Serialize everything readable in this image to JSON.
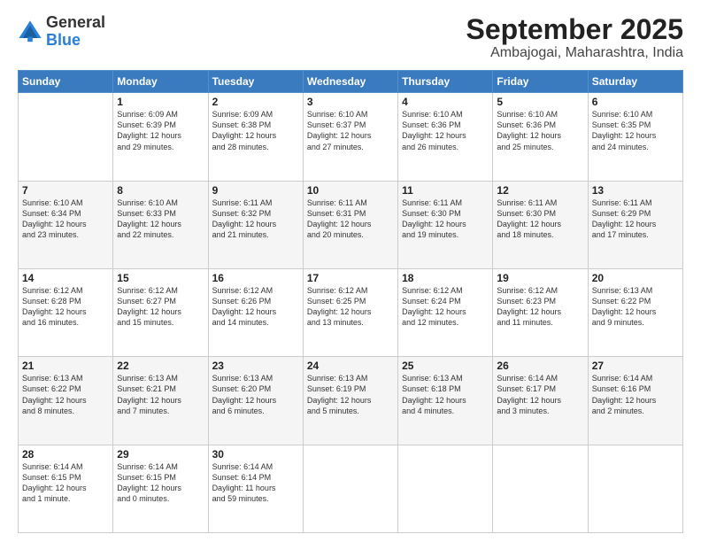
{
  "logo": {
    "general": "General",
    "blue": "Blue"
  },
  "header": {
    "month": "September 2025",
    "location": "Ambajogai, Maharashtra, India"
  },
  "weekdays": [
    "Sunday",
    "Monday",
    "Tuesday",
    "Wednesday",
    "Thursday",
    "Friday",
    "Saturday"
  ],
  "weeks": [
    [
      {
        "day": "",
        "info": ""
      },
      {
        "day": "1",
        "info": "Sunrise: 6:09 AM\nSunset: 6:39 PM\nDaylight: 12 hours\nand 29 minutes."
      },
      {
        "day": "2",
        "info": "Sunrise: 6:09 AM\nSunset: 6:38 PM\nDaylight: 12 hours\nand 28 minutes."
      },
      {
        "day": "3",
        "info": "Sunrise: 6:10 AM\nSunset: 6:37 PM\nDaylight: 12 hours\nand 27 minutes."
      },
      {
        "day": "4",
        "info": "Sunrise: 6:10 AM\nSunset: 6:36 PM\nDaylight: 12 hours\nand 26 minutes."
      },
      {
        "day": "5",
        "info": "Sunrise: 6:10 AM\nSunset: 6:36 PM\nDaylight: 12 hours\nand 25 minutes."
      },
      {
        "day": "6",
        "info": "Sunrise: 6:10 AM\nSunset: 6:35 PM\nDaylight: 12 hours\nand 24 minutes."
      }
    ],
    [
      {
        "day": "7",
        "info": "Sunrise: 6:10 AM\nSunset: 6:34 PM\nDaylight: 12 hours\nand 23 minutes."
      },
      {
        "day": "8",
        "info": "Sunrise: 6:10 AM\nSunset: 6:33 PM\nDaylight: 12 hours\nand 22 minutes."
      },
      {
        "day": "9",
        "info": "Sunrise: 6:11 AM\nSunset: 6:32 PM\nDaylight: 12 hours\nand 21 minutes."
      },
      {
        "day": "10",
        "info": "Sunrise: 6:11 AM\nSunset: 6:31 PM\nDaylight: 12 hours\nand 20 minutes."
      },
      {
        "day": "11",
        "info": "Sunrise: 6:11 AM\nSunset: 6:30 PM\nDaylight: 12 hours\nand 19 minutes."
      },
      {
        "day": "12",
        "info": "Sunrise: 6:11 AM\nSunset: 6:30 PM\nDaylight: 12 hours\nand 18 minutes."
      },
      {
        "day": "13",
        "info": "Sunrise: 6:11 AM\nSunset: 6:29 PM\nDaylight: 12 hours\nand 17 minutes."
      }
    ],
    [
      {
        "day": "14",
        "info": "Sunrise: 6:12 AM\nSunset: 6:28 PM\nDaylight: 12 hours\nand 16 minutes."
      },
      {
        "day": "15",
        "info": "Sunrise: 6:12 AM\nSunset: 6:27 PM\nDaylight: 12 hours\nand 15 minutes."
      },
      {
        "day": "16",
        "info": "Sunrise: 6:12 AM\nSunset: 6:26 PM\nDaylight: 12 hours\nand 14 minutes."
      },
      {
        "day": "17",
        "info": "Sunrise: 6:12 AM\nSunset: 6:25 PM\nDaylight: 12 hours\nand 13 minutes."
      },
      {
        "day": "18",
        "info": "Sunrise: 6:12 AM\nSunset: 6:24 PM\nDaylight: 12 hours\nand 12 minutes."
      },
      {
        "day": "19",
        "info": "Sunrise: 6:12 AM\nSunset: 6:23 PM\nDaylight: 12 hours\nand 11 minutes."
      },
      {
        "day": "20",
        "info": "Sunrise: 6:13 AM\nSunset: 6:22 PM\nDaylight: 12 hours\nand 9 minutes."
      }
    ],
    [
      {
        "day": "21",
        "info": "Sunrise: 6:13 AM\nSunset: 6:22 PM\nDaylight: 12 hours\nand 8 minutes."
      },
      {
        "day": "22",
        "info": "Sunrise: 6:13 AM\nSunset: 6:21 PM\nDaylight: 12 hours\nand 7 minutes."
      },
      {
        "day": "23",
        "info": "Sunrise: 6:13 AM\nSunset: 6:20 PM\nDaylight: 12 hours\nand 6 minutes."
      },
      {
        "day": "24",
        "info": "Sunrise: 6:13 AM\nSunset: 6:19 PM\nDaylight: 12 hours\nand 5 minutes."
      },
      {
        "day": "25",
        "info": "Sunrise: 6:13 AM\nSunset: 6:18 PM\nDaylight: 12 hours\nand 4 minutes."
      },
      {
        "day": "26",
        "info": "Sunrise: 6:14 AM\nSunset: 6:17 PM\nDaylight: 12 hours\nand 3 minutes."
      },
      {
        "day": "27",
        "info": "Sunrise: 6:14 AM\nSunset: 6:16 PM\nDaylight: 12 hours\nand 2 minutes."
      }
    ],
    [
      {
        "day": "28",
        "info": "Sunrise: 6:14 AM\nSunset: 6:15 PM\nDaylight: 12 hours\nand 1 minute."
      },
      {
        "day": "29",
        "info": "Sunrise: 6:14 AM\nSunset: 6:15 PM\nDaylight: 12 hours\nand 0 minutes."
      },
      {
        "day": "30",
        "info": "Sunrise: 6:14 AM\nSunset: 6:14 PM\nDaylight: 11 hours\nand 59 minutes."
      },
      {
        "day": "",
        "info": ""
      },
      {
        "day": "",
        "info": ""
      },
      {
        "day": "",
        "info": ""
      },
      {
        "day": "",
        "info": ""
      }
    ]
  ]
}
